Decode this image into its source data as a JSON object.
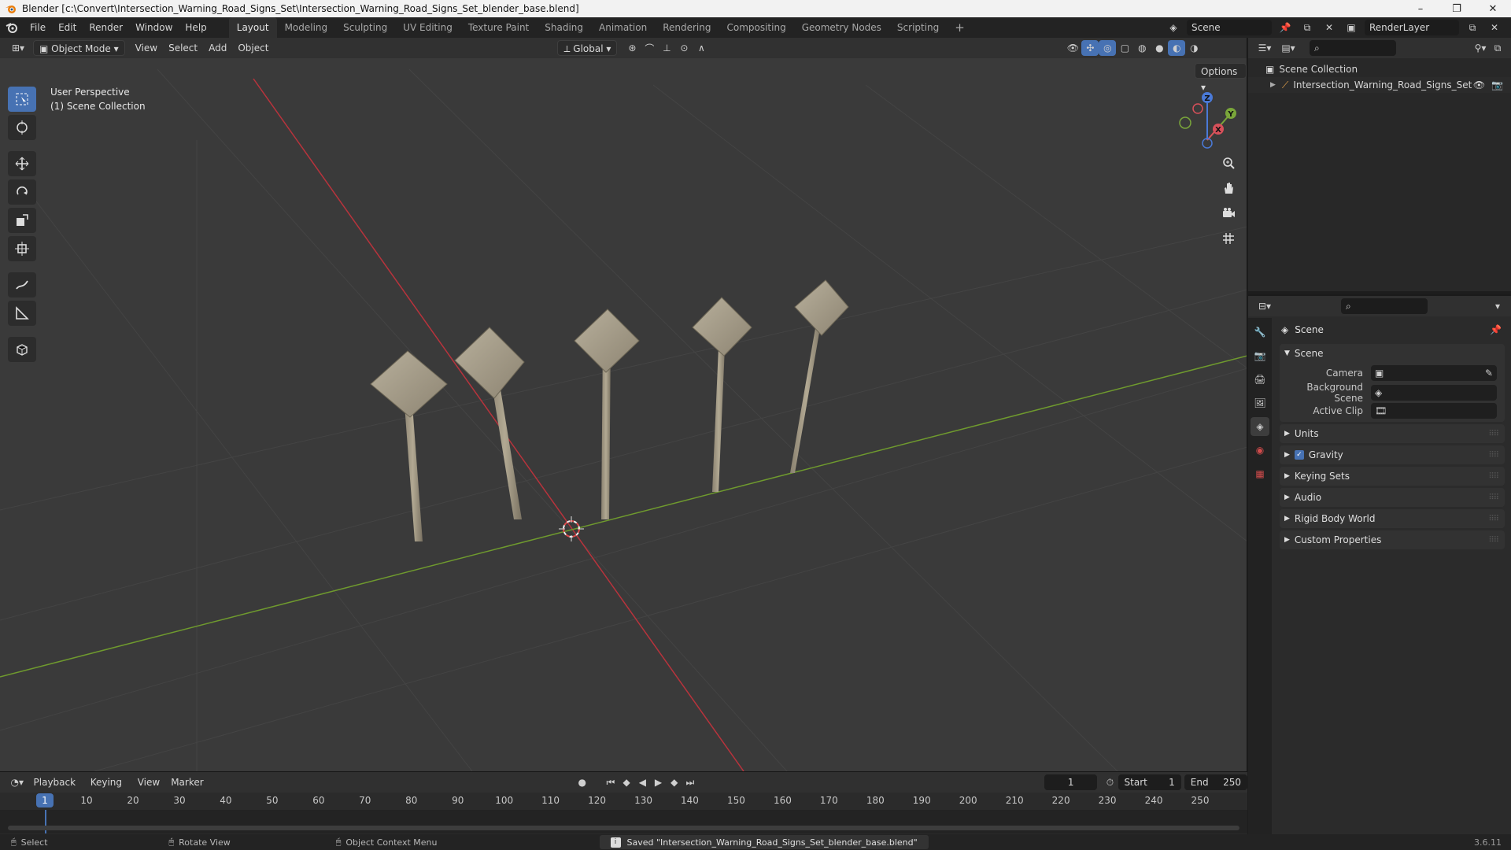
{
  "window": {
    "title": "Blender [c:\\Convert\\Intersection_Warning_Road_Signs_Set\\Intersection_Warning_Road_Signs_Set_blender_base.blend]",
    "minimize": "–",
    "maximize": "❐",
    "close": "✕"
  },
  "menu": {
    "items": [
      "File",
      "Edit",
      "Render",
      "Window",
      "Help"
    ]
  },
  "workspaces": {
    "tabs": [
      "Layout",
      "Modeling",
      "Sculpting",
      "UV Editing",
      "Texture Paint",
      "Shading",
      "Animation",
      "Rendering",
      "Compositing",
      "Geometry Nodes",
      "Scripting"
    ],
    "active": "Layout",
    "add": "+"
  },
  "scene_selector": {
    "scene": "Scene",
    "view_layer": "RenderLayer"
  },
  "viewport": {
    "mode": "Object Mode",
    "menus": [
      "View",
      "Select",
      "Add",
      "Object"
    ],
    "orientation": "Global",
    "options": "Options",
    "perspective": "User Perspective",
    "collection": "(1) Scene Collection",
    "gizmo": {
      "x": "X",
      "y": "Y",
      "z": "Z"
    }
  },
  "outliner": {
    "root": "Scene Collection",
    "items": [
      "Intersection_Warning_Road_Signs_Set"
    ]
  },
  "properties": {
    "context_title": "Scene",
    "panel_scene": "Scene",
    "camera_label": "Camera",
    "background_scene_label": "Background Scene",
    "active_clip_label": "Active Clip",
    "panels": [
      "Units",
      "Gravity",
      "Keying Sets",
      "Audio",
      "Rigid Body World",
      "Custom Properties"
    ],
    "gravity_checked": true
  },
  "timeline": {
    "menus": [
      "Playback",
      "Keying",
      "View",
      "Marker"
    ],
    "current_frame": "1",
    "start_label": "Start",
    "start": "1",
    "end_label": "End",
    "end": "250",
    "ticks": [
      "10",
      "20",
      "30",
      "40",
      "50",
      "60",
      "70",
      "80",
      "90",
      "100",
      "110",
      "120",
      "130",
      "140",
      "150",
      "160",
      "170",
      "180",
      "190",
      "200",
      "210",
      "220",
      "230",
      "240",
      "250"
    ]
  },
  "statusbar": {
    "select": "Select",
    "rotate": "Rotate View",
    "context_menu": "Object Context Menu",
    "message": "Saved \"Intersection_Warning_Road_Signs_Set_blender_base.blend\"",
    "version": "3.6.11"
  },
  "colors": {
    "accent": "#4772b3",
    "x_axis": "#b8333c",
    "y_axis": "#6f9a2e",
    "viewport_bg": "#3a3a3a"
  }
}
